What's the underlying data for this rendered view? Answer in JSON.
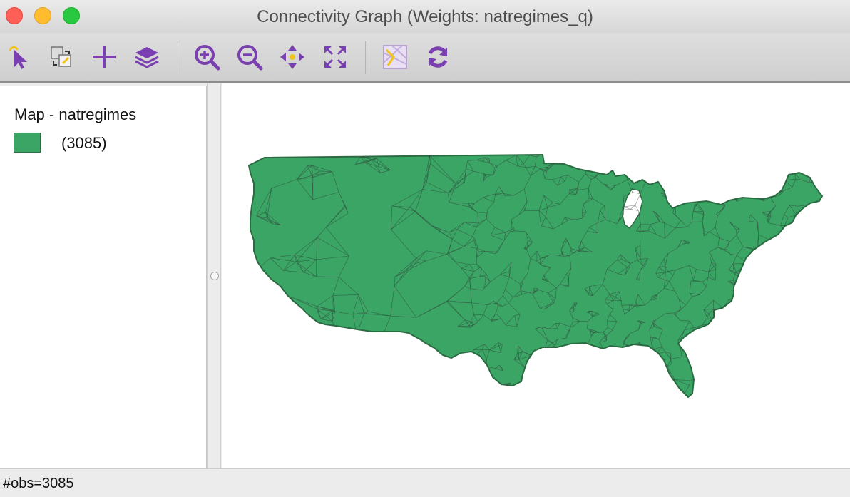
{
  "window": {
    "title": "Connectivity Graph (Weights: natregimes_q)"
  },
  "toolbar": {
    "buttons": [
      {
        "name": "select-tool",
        "icon": "select-arrow-icon"
      },
      {
        "name": "selection-mode",
        "icon": "selection-mode-icon"
      },
      {
        "name": "add",
        "icon": "plus-icon"
      },
      {
        "name": "layers",
        "icon": "layers-icon"
      },
      {
        "name": "zoom-in",
        "icon": "zoom-in-icon"
      },
      {
        "name": "zoom-out",
        "icon": "zoom-out-icon"
      },
      {
        "name": "pan",
        "icon": "pan-icon"
      },
      {
        "name": "full-extent",
        "icon": "full-extent-icon"
      },
      {
        "name": "basemap",
        "icon": "basemap-icon"
      },
      {
        "name": "refresh",
        "icon": "refresh-icon"
      }
    ]
  },
  "legend": {
    "title": "Map - natregimes",
    "items": [
      {
        "label": "(3085)",
        "color": "#3aa565"
      }
    ]
  },
  "map": {
    "fill_color": "#3aa565",
    "edge_color": "#333333",
    "outline_color": "#2b6b42"
  },
  "status": {
    "text": "#obs=3085"
  },
  "colors": {
    "icon_purple": "#7a3fb0",
    "icon_yellow": "#f0c419"
  }
}
